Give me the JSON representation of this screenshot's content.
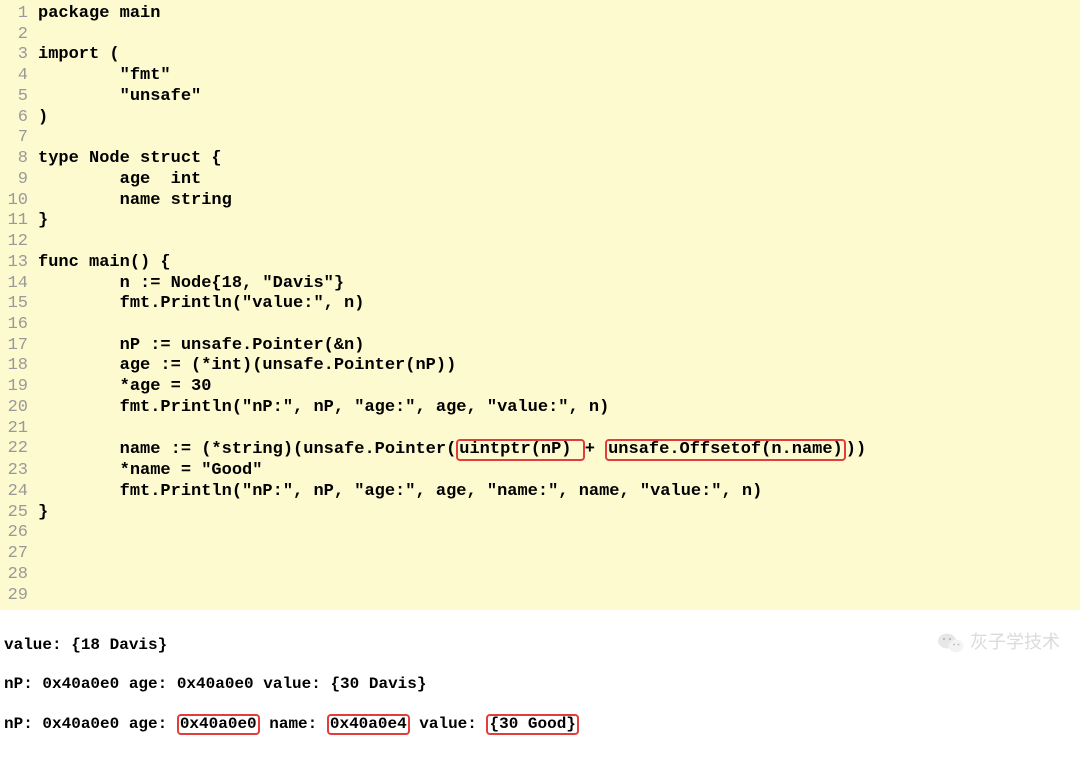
{
  "code": {
    "lines": [
      {
        "n": "1",
        "t": "package main"
      },
      {
        "n": "2",
        "t": ""
      },
      {
        "n": "3",
        "t": "import ("
      },
      {
        "n": "4",
        "t": "        \"fmt\""
      },
      {
        "n": "5",
        "t": "        \"unsafe\""
      },
      {
        "n": "6",
        "t": ")"
      },
      {
        "n": "7",
        "t": ""
      },
      {
        "n": "8",
        "t": "type Node struct {"
      },
      {
        "n": "9",
        "t": "        age  int"
      },
      {
        "n": "10",
        "t": "        name string"
      },
      {
        "n": "11",
        "t": "}"
      },
      {
        "n": "12",
        "t": ""
      },
      {
        "n": "13",
        "t": "func main() {"
      },
      {
        "n": "14",
        "t": "        n := Node{18, \"Davis\"}"
      },
      {
        "n": "15",
        "t": "        fmt.Println(\"value:\", n)"
      },
      {
        "n": "16",
        "t": ""
      },
      {
        "n": "17",
        "t": "        nP := unsafe.Pointer(&n)"
      },
      {
        "n": "18",
        "t": "        age := (*int)(unsafe.Pointer(nP))"
      },
      {
        "n": "19",
        "t": "        *age = 30"
      },
      {
        "n": "20",
        "t": "        fmt.Println(\"nP:\", nP, \"age:\", age, \"value:\", n)"
      },
      {
        "n": "21",
        "t": ""
      },
      {
        "n": "22",
        "t": "SPECIAL22"
      },
      {
        "n": "23",
        "t": "        *name = \"Good\""
      },
      {
        "n": "24",
        "t": "        fmt.Println(\"nP:\", nP, \"age:\", age, \"name:\", name, \"value:\", n)"
      },
      {
        "n": "25",
        "t": "}"
      },
      {
        "n": "26",
        "t": ""
      },
      {
        "n": "27",
        "t": ""
      },
      {
        "n": "28",
        "t": ""
      },
      {
        "n": "29",
        "t": ""
      }
    ],
    "line22": {
      "pre": "        name := (*string)(unsafe.Pointer(",
      "box1": "uintptr(nP) ",
      "mid": "+ ",
      "box2": "unsafe.Offsetof(n.name)",
      "post": "))"
    }
  },
  "output": {
    "line1": "value: {18 Davis}",
    "line2": "nP: 0x40a0e0 age: 0x40a0e0 value: {30 Davis}",
    "line3": {
      "pre": "nP: 0x40a0e0 age: ",
      "box1": "0x40a0e0",
      "mid1": " name: ",
      "box2": "0x40a0e4",
      "mid2": " value: ",
      "box3": "{30 Good}"
    }
  },
  "watermark": "灰子学技术"
}
